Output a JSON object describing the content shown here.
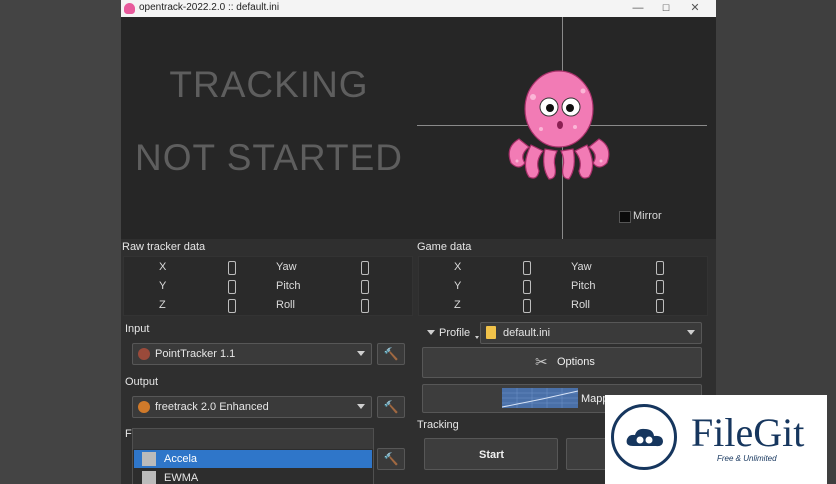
{
  "window": {
    "title": "opentrack-2022.2.0 :: default.ini",
    "minimize": "—",
    "maximize": "☐",
    "close": "✕"
  },
  "status": {
    "line1": "TRACKING",
    "line2": "NOT STARTED"
  },
  "preview": {
    "mirror_label": "Mirror",
    "mirror_checked": false
  },
  "raw": {
    "label": "Raw tracker data",
    "axes": [
      "X",
      "Y",
      "Z"
    ],
    "rotations": [
      "Yaw",
      "Pitch",
      "Roll"
    ]
  },
  "game": {
    "label": "Game data",
    "axes": [
      "X",
      "Y",
      "Z"
    ],
    "rotations": [
      "Yaw",
      "Pitch",
      "Roll"
    ]
  },
  "input": {
    "label": "Input",
    "value": "PointTracker 1.1"
  },
  "output": {
    "label": "Output",
    "value": "freetrack 2.0 Enhanced"
  },
  "filter": {
    "label": "Fi",
    "options": [
      "Accela",
      "EWMA"
    ],
    "selected": "Accela"
  },
  "profile": {
    "label": "Profile",
    "value": "default.ini"
  },
  "buttons": {
    "options": "Options",
    "mapping": "Mapp",
    "start": "Start"
  },
  "tracking": {
    "label": "Tracking"
  },
  "watermark": {
    "brand": "FileGit",
    "tagline": "Free & Unlimited"
  },
  "colors": {
    "selection": "#2f76c9",
    "watermark_blue": "#16365e",
    "octopus_pink": "#f27bb5"
  }
}
